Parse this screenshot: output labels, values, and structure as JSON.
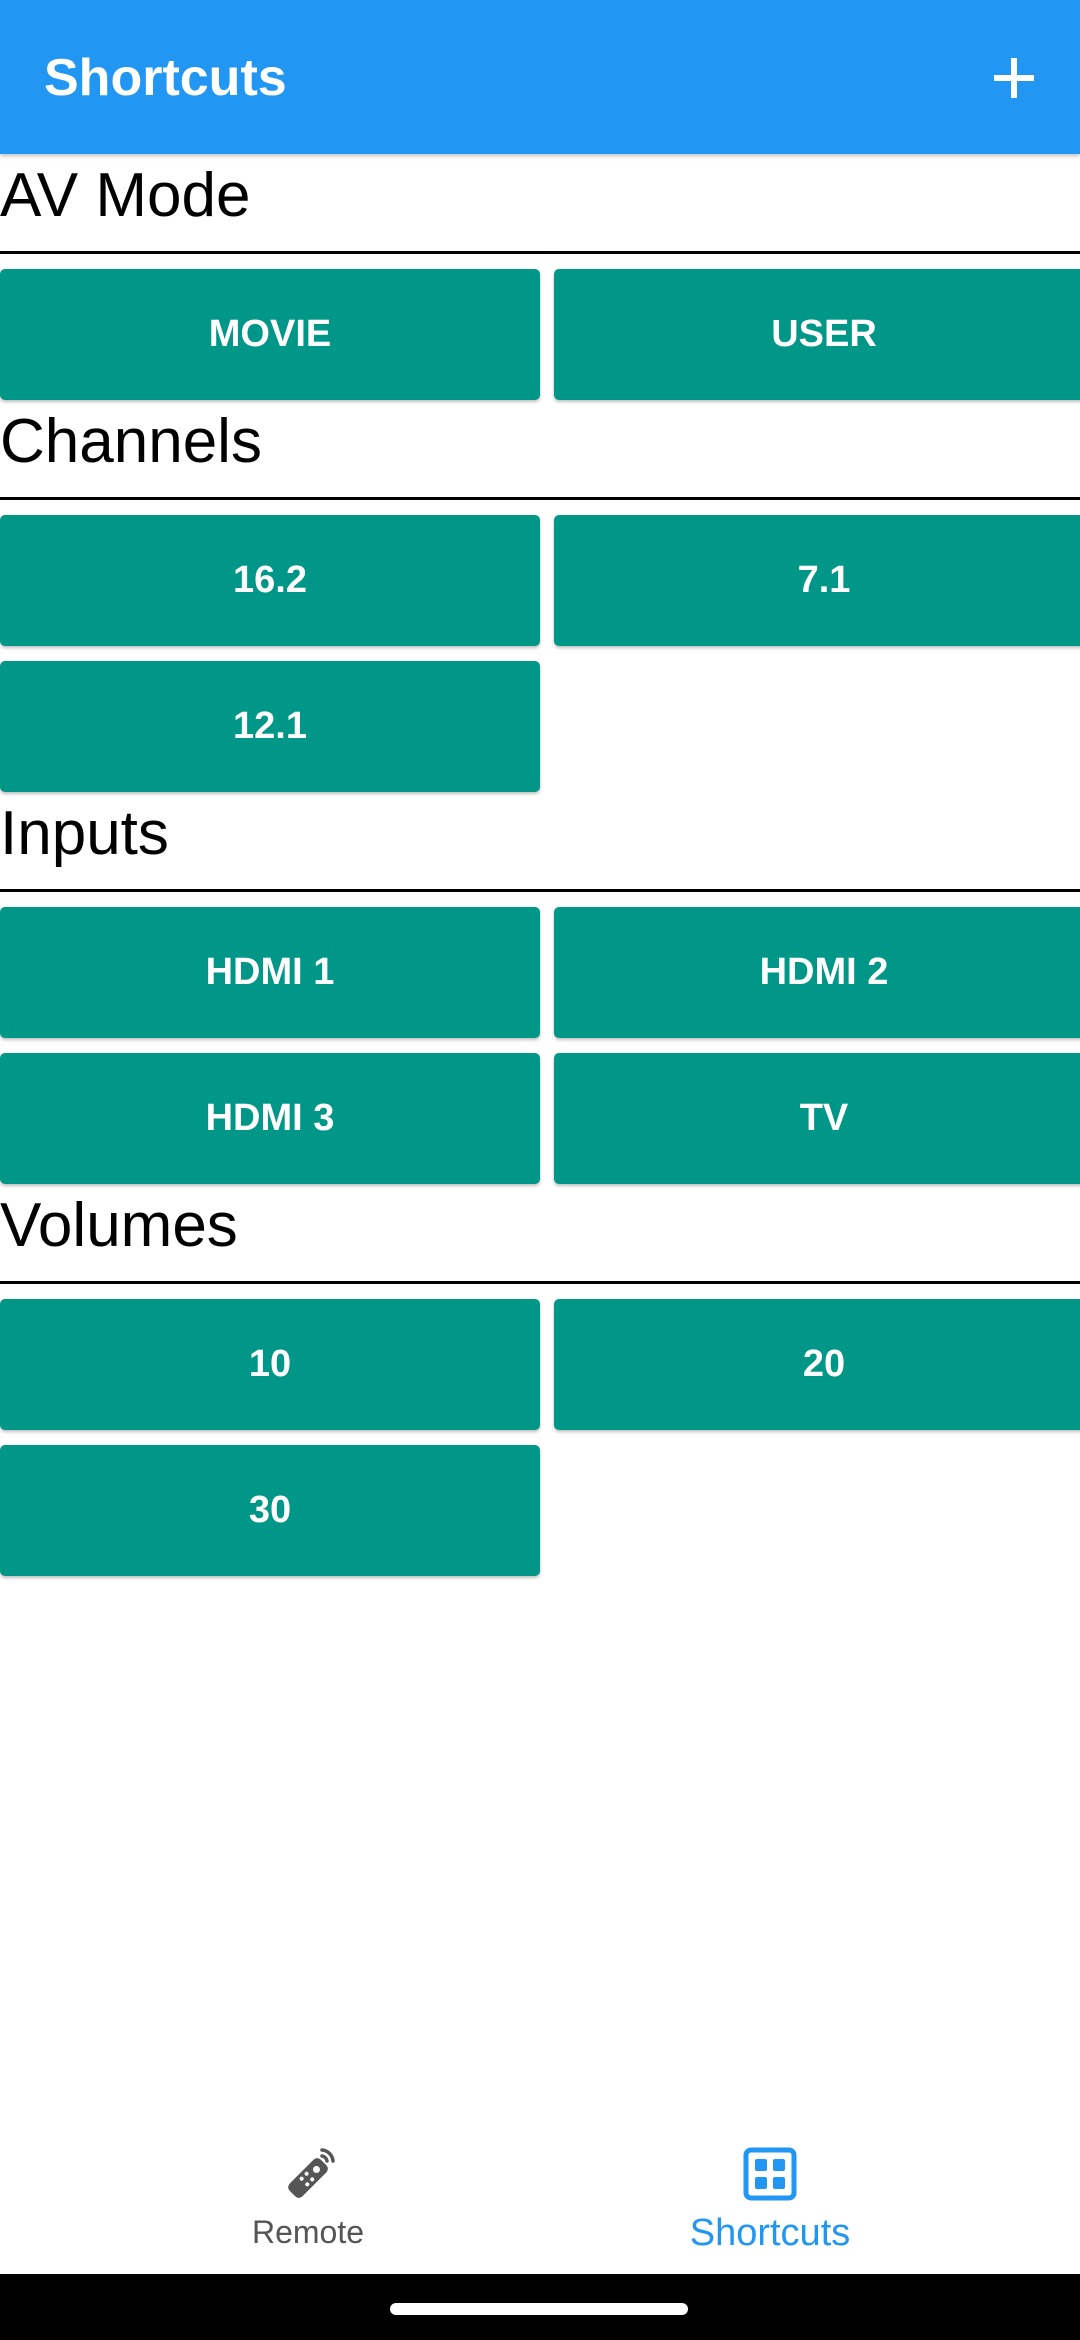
{
  "app_bar": {
    "title": "Shortcuts",
    "add_icon": "plus-icon",
    "background_color": "#2196F3"
  },
  "button_color": "#009688",
  "sections": [
    {
      "title": "AV Mode",
      "buttons": [
        "MOVIE",
        "USER"
      ]
    },
    {
      "title": "Channels",
      "buttons": [
        "16.2",
        "7.1",
        "12.1"
      ]
    },
    {
      "title": "Inputs",
      "buttons": [
        "HDMI 1",
        "HDMI 2",
        "HDMI 3",
        "TV"
      ]
    },
    {
      "title": "Volumes",
      "buttons": [
        "10",
        "20",
        "30"
      ]
    }
  ],
  "bottom_nav": {
    "items": [
      {
        "label": "Remote",
        "icon": "remote-control-icon",
        "active": false
      },
      {
        "label": "Shortcuts",
        "icon": "grid-icon",
        "active": true
      }
    ],
    "active_color": "#2196F3"
  }
}
